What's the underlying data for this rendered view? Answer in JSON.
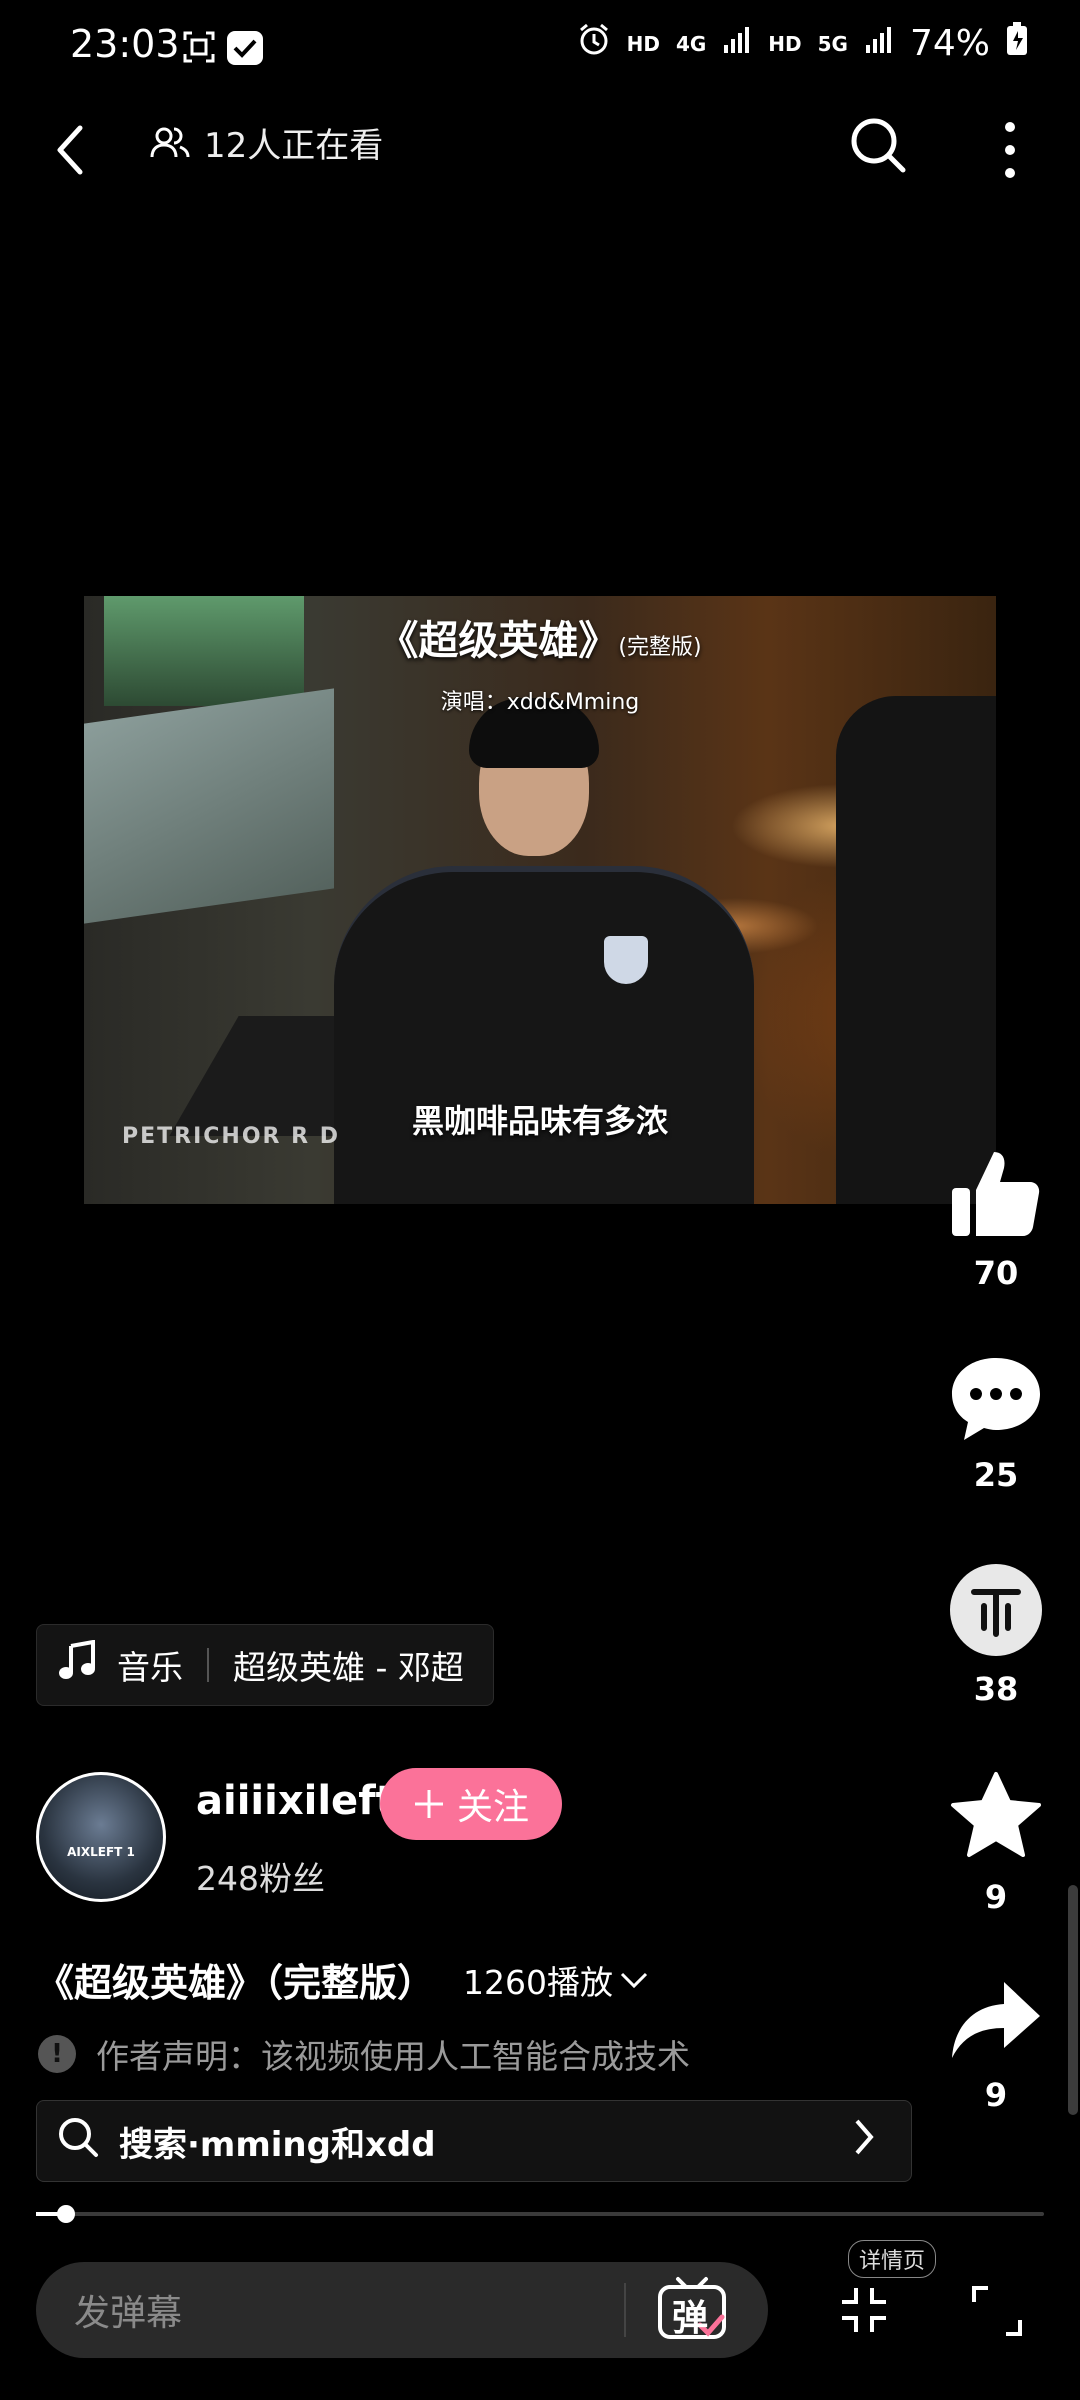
{
  "status_bar": {
    "time": "23:03",
    "hd1": "HD",
    "net1": "4G",
    "hd2": "HD",
    "net2": "5G",
    "battery": "74%"
  },
  "top_nav": {
    "viewers_text": "12人正在看"
  },
  "video": {
    "title": "《超级英雄》",
    "title_suffix": "(完整版)",
    "singer": "演唱：xdd&Mming",
    "caption": "黑咖啡品味有多浓",
    "watermark": "PETRICHOR R D"
  },
  "actions": {
    "like_count": "70",
    "comment_count": "25",
    "coin_count": "38",
    "favorite_count": "9",
    "share_count": "9"
  },
  "music": {
    "label": "音乐",
    "track": "超级英雄 - 邓超"
  },
  "author": {
    "username": "aiiiixileft",
    "follow_label": "关注",
    "fans": "248粉丝",
    "avatar_text": "AIXLEFT 1"
  },
  "info": {
    "title": "《超级英雄》（完整版）",
    "plays": "1260播放",
    "notice": "作者声明：该视频使用人工智能合成技术"
  },
  "search": {
    "query": "搜索·mming和xdd"
  },
  "bottom": {
    "danmaku_placeholder": "发弹幕",
    "danmaku_icon_char": "弹",
    "detail_label": "详情页"
  },
  "progress_fraction": 0.03,
  "colors": {
    "accent": "#fb7299",
    "background": "#000000"
  }
}
